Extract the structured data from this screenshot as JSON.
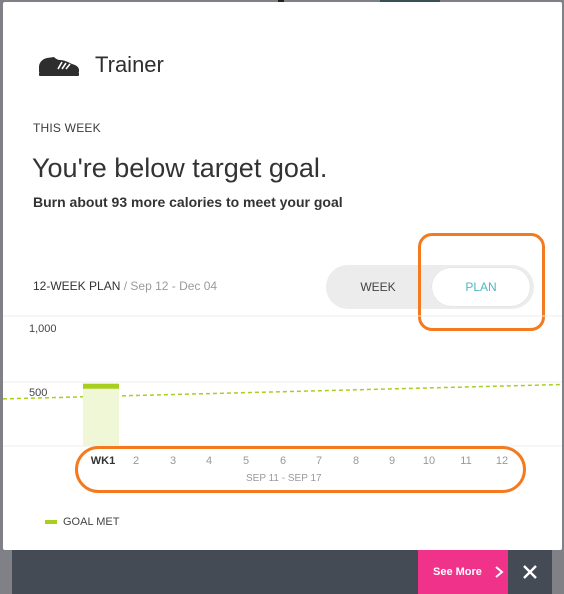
{
  "header": {
    "title": "Trainer",
    "icon": "sneaker-icon"
  },
  "status": {
    "section_label": "THIS WEEK",
    "headline": "You're below target goal.",
    "subline": "Burn about 93 more calories to meet your goal"
  },
  "plan": {
    "label": "12-WEEK PLAN",
    "range": "/ Sep 12 - Dec 04",
    "toggle": {
      "week_label": "WEEK",
      "plan_label": "PLAN",
      "selected": "PLAN"
    }
  },
  "chart_data": {
    "type": "bar",
    "y_ticks": [
      "1,000",
      "500"
    ],
    "ylim": [
      0,
      1000
    ],
    "categories": [
      "WK1",
      "2",
      "3",
      "4",
      "5",
      "6",
      "7",
      "8",
      "9",
      "10",
      "11",
      "12"
    ],
    "values": [
      487
    ],
    "goal_line": {
      "start": 372,
      "end": 481
    },
    "active_week": "WK1",
    "active_week_dates": "SEP 11 - SEP 17",
    "legend": [
      {
        "label": "GOAL MET",
        "color": "#a8cf1e"
      }
    ]
  },
  "footer": {
    "see_more_label": "See More",
    "close_icon": "close-icon"
  },
  "colors": {
    "accent_teal": "#4fb7c6",
    "goal_green": "#a8cf1e",
    "see_more_pink": "#f0328a",
    "annotation_orange": "#f47a20"
  }
}
